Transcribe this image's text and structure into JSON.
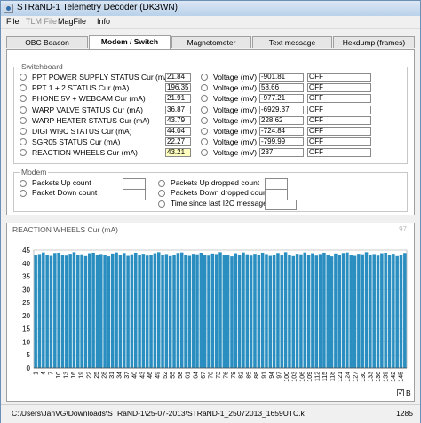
{
  "window": {
    "title": "STRaND-1 Telemetry Decoder (DK3WN)"
  },
  "menu": [
    {
      "label": "File",
      "disabled": false
    },
    {
      "label": "TLM File",
      "disabled": true
    },
    {
      "label": "MagFile",
      "disabled": false
    },
    {
      "label": "Info",
      "disabled": false
    }
  ],
  "tabs": [
    "OBC Beacon",
    "Modem / Switch",
    "Magnetometer",
    "Text message",
    "Hexdump (frames)"
  ],
  "active_tab": "Modem / Switch",
  "switchboard": {
    "title": "Switchboard",
    "rows": [
      {
        "label": "PPT POWER SUPPLY STATUS Cur (mA)",
        "current": "21.84",
        "voltage_label": "Voltage (mV)",
        "voltage": "-901.81",
        "state": "OFF"
      },
      {
        "label": "PPT 1 + 2 STATUS Cur (mA)",
        "current": "196.35",
        "voltage_label": "Voltage (mV)",
        "voltage": "58.66",
        "state": "OFF"
      },
      {
        "label": "PHONE 5V + WEBCAM Cur (mA)",
        "current": "21.91",
        "voltage_label": "Voltage (mV)",
        "voltage": "-977.21",
        "state": "OFF"
      },
      {
        "label": "WARP VALVE STATUS Cur (mA)",
        "current": "36.87",
        "voltage_label": "Voltage (mV)",
        "voltage": "-6929.37",
        "state": "OFF"
      },
      {
        "label": "WARP HEATER STATUS Cur (mA)",
        "current": "43.79",
        "voltage_label": "Voltage (mV)",
        "voltage": "228.62",
        "state": "OFF"
      },
      {
        "label": "DIGI WI9C STATUS Cur (mA)",
        "current": "44.04",
        "voltage_label": "Voltage (mV)",
        "voltage": "-724.84",
        "state": "OFF"
      },
      {
        "label": "SGR05 STATUS Cur (mA)",
        "current": "22.27",
        "voltage_label": "Voltage (mV)",
        "voltage": "-799.99",
        "state": "OFF"
      },
      {
        "label": "REACTION WHEELS Cur (mA)",
        "current": "43.21",
        "voltage_label": "Voltage (mV)",
        "voltage": "237.",
        "state": "OFF",
        "selected": true
      }
    ]
  },
  "modem": {
    "title": "Modem",
    "left": [
      {
        "label": "Packets Up count",
        "value": ""
      },
      {
        "label": "Packet Down count",
        "value": ""
      }
    ],
    "right": [
      {
        "label": "Packets Up dropped count",
        "value": ""
      },
      {
        "label": "Packets Down dropped count",
        "value": ""
      },
      {
        "label": "Time since last I2C message",
        "value": ""
      }
    ]
  },
  "chart_data": {
    "type": "bar",
    "title": "REACTION WHEELS Cur (mA)",
    "current_value": "97",
    "bar_color": "#2a8fc0",
    "ylim": [
      0,
      45
    ],
    "yticks": [
      0,
      5,
      10,
      15,
      20,
      25,
      30,
      35,
      40,
      45
    ],
    "grid": true,
    "legend": "B",
    "legend_checked": true,
    "n_bars": 97,
    "values": [
      43.2,
      43.5,
      44.1,
      43.0,
      42.8,
      43.9,
      44.0,
      43.3,
      42.9,
      43.6,
      44.2,
      43.1,
      43.4,
      42.7,
      43.8,
      44.0,
      43.2,
      43.5,
      43.0,
      42.6,
      43.7,
      44.1,
      43.3,
      43.9,
      42.8,
      43.4,
      44.0,
      43.1,
      43.6,
      42.9,
      43.2,
      43.8,
      44.2,
      43.0,
      43.5,
      42.7,
      43.3,
      43.9,
      44.1,
      43.2,
      42.8,
      43.6,
      43.4,
      44.0,
      43.1,
      42.9,
      43.7,
      43.5,
      44.2,
      43.3,
      43.0,
      42.6,
      43.8,
      43.2,
      44.1,
      43.4,
      42.9,
      43.6,
      43.1,
      44.0,
      43.5,
      42.8,
      43.3,
      43.9,
      43.2,
      44.2,
      43.0,
      42.7,
      43.6,
      43.4,
      44.1,
      43.1,
      43.8,
      42.9,
      43.5,
      44.0,
      43.2,
      42.6,
      43.7,
      43.3,
      43.9,
      44.1,
      43.0,
      42.8,
      43.6,
      43.4,
      44.2,
      43.1,
      43.5,
      42.9,
      43.8,
      44.0,
      43.2,
      43.6,
      42.7,
      43.3,
      43.9
    ],
    "x_tick_labels": [
      "1",
      "4",
      "7",
      "10",
      "13",
      "16",
      "19",
      "22",
      "25",
      "28",
      "31",
      "34",
      "37",
      "40",
      "43",
      "46",
      "49",
      "52",
      "55",
      "58",
      "61",
      "64",
      "67",
      "70",
      "73",
      "76",
      "79",
      "82",
      "85",
      "88",
      "91",
      "94",
      "97",
      "100",
      "103",
      "106",
      "109",
      "112",
      "115",
      "118",
      "121",
      "124",
      "127",
      "130",
      "133",
      "136",
      "139",
      "142",
      "145"
    ]
  },
  "status": {
    "path": "C:\\Users\\JanVG\\Downloads\\STRaND-1\\25-07-2013\\STRaND-1_25072013_1659UTC.k",
    "count": "1285"
  }
}
